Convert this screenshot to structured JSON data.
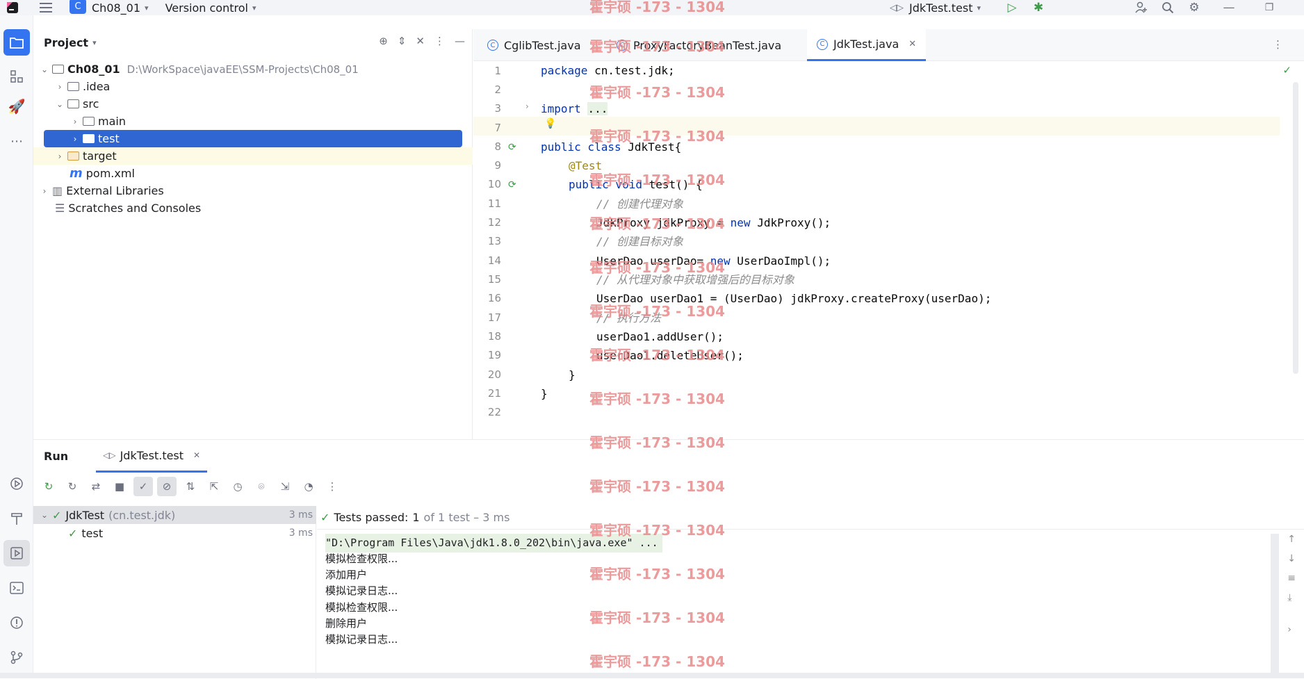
{
  "titlebar": {
    "project_badge": "C",
    "project_name": "Ch08_01",
    "vcs": "Version control",
    "run_config": "JdkTest.test"
  },
  "project_panel": {
    "title": "Project",
    "tree": [
      {
        "label": "Ch08_01",
        "path": "D:\\WorkSpace\\javaEE\\SSM-Projects\\Ch08_01"
      },
      {
        "label": ".idea"
      },
      {
        "label": "src"
      },
      {
        "label": "main"
      },
      {
        "label": "test"
      },
      {
        "label": "target"
      },
      {
        "label": "pom.xml"
      },
      {
        "label": "External Libraries"
      },
      {
        "label": "Scratches and Consoles"
      }
    ]
  },
  "editor": {
    "tabs": [
      {
        "label": "CglibTest.java"
      },
      {
        "label": "ProxyFactoryBeanTest.java"
      },
      {
        "label": "JdkTest.java"
      }
    ],
    "line_numbers": [
      "1",
      "2",
      "3",
      "7",
      "8",
      "9",
      "10",
      "11",
      "12",
      "13",
      "14",
      "15",
      "16",
      "17",
      "18",
      "19",
      "20",
      "21",
      "22"
    ],
    "code": {
      "l1_kw": "package",
      "l1_rest": " cn.test.jdk;",
      "l3_kw": "import",
      "l3_fold": "...",
      "l8_kw": "public class",
      "l8_rest": " JdkTest{",
      "l9": "@Test",
      "l10_kw": "public void",
      "l10_rest": " test() {",
      "l11": "// 创建代理对象",
      "l12_a": "JdkProxy jdkProxy = ",
      "l12_kw": "new",
      "l12_b": " JdkProxy();",
      "l13": "// 创建目标对象",
      "l14_a": "UserDao userDao= ",
      "l14_kw": "new",
      "l14_b": " UserDaoImpl();",
      "l15": "// 从代理对象中获取增强后的目标对象",
      "l16": "UserDao userDao1 = (UserDao) jdkProxy.createProxy(userDao);",
      "l17": "// 执行方法",
      "l18": "userDao1.addUser();",
      "l19": "userDao1.deleteUser();",
      "l20": "}",
      "l21": "}"
    }
  },
  "run_panel": {
    "title": "Run",
    "tab_label": "JdkTest.test",
    "tree": [
      {
        "label": "JdkTest",
        "pkg": "(cn.test.jdk)",
        "duration": "3 ms"
      },
      {
        "label": "test",
        "duration": "3 ms"
      }
    ],
    "status": {
      "prefix": "Tests passed:",
      "count": "1",
      "rest": "of 1 test – 3 ms"
    },
    "console": [
      "\"D:\\Program Files\\Java\\jdk1.8.0_202\\bin\\java.exe\" ...",
      "模拟检查权限...",
      "添加用户",
      "模拟记录日志...",
      "模拟检查权限...",
      "删除用户",
      "模拟记录日志..."
    ]
  },
  "watermark": "霍宇硕 -173 - 1304",
  "colors": {
    "accent": "#3574f0",
    "selected": "#2f66d2",
    "keyword": "#0033b3",
    "annotation": "#9e880d",
    "success": "#3e9b48"
  }
}
